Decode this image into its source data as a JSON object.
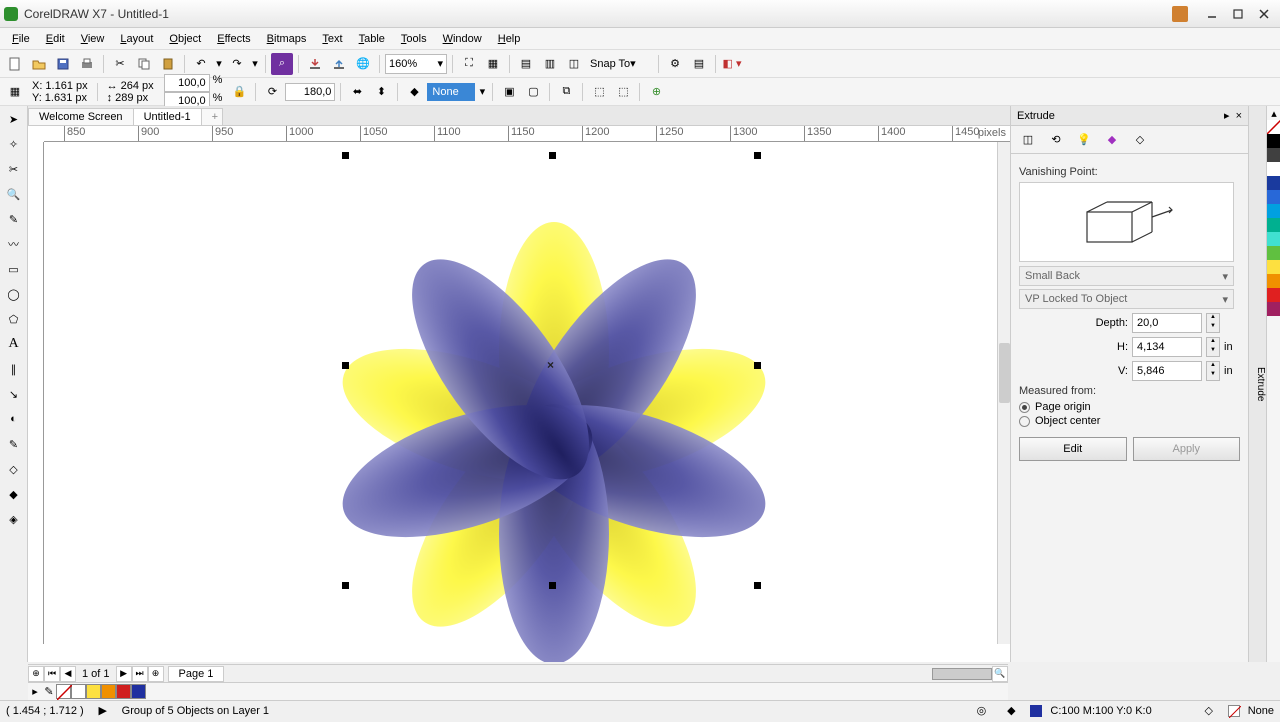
{
  "app": {
    "title": "CorelDRAW X7 - Untitled-1"
  },
  "menus": [
    "File",
    "Edit",
    "View",
    "Layout",
    "Object",
    "Effects",
    "Bitmaps",
    "Text",
    "Table",
    "Tools",
    "Window",
    "Help"
  ],
  "toolbar1": {
    "zoom": "160%",
    "snap": "Snap To"
  },
  "props": {
    "x_label": "X:",
    "x": "1.161 px",
    "y_label": "Y:",
    "y": "1.631 px",
    "w": "264 px",
    "h": "289 px",
    "sx": "100,0",
    "sy": "100,0",
    "pct": "%",
    "rot": "180,0",
    "fill": "None"
  },
  "doc_tabs": {
    "welcome": "Welcome Screen",
    "doc": "Untitled-1"
  },
  "ruler_ticks": [
    "850",
    "900",
    "950",
    "1000",
    "1050",
    "1100",
    "1150",
    "1200",
    "1250",
    "1300",
    "1350",
    "1400",
    "1450"
  ],
  "ruler_unit": "pixels",
  "docker": {
    "title": "Extrude",
    "vp_label": "Vanishing Point:",
    "preset": "Small Back",
    "lock": "VP Locked To Object",
    "depth_label": "Depth:",
    "depth": "20,0",
    "h_label": "H:",
    "h_val": "4,134",
    "unit": "in",
    "v_label": "V:",
    "v_val": "5,846",
    "measured": "Measured from:",
    "opt1": "Page origin",
    "opt2": "Object center",
    "edit": "Edit",
    "apply": "Apply"
  },
  "page_nav": {
    "count": "1 of 1",
    "page": "Page 1"
  },
  "status": {
    "coords": "( 1.454 ; 1.712 )",
    "selection": "Group of 5 Objects on Layer 1",
    "color": "C:100 M:100 Y:0 K:0",
    "outline": "None"
  },
  "palette_colors": [
    "#000000",
    "#404040",
    "#ffffff",
    "#1a3a9e",
    "#2868d8",
    "#00a0e0",
    "#00b090",
    "#40e0d0",
    "#60c040",
    "#fde040",
    "#f09000",
    "#e02020",
    "#a02060"
  ],
  "swatch_colors": [
    "#ffffff",
    "#fde040",
    "#f09000",
    "#d02020",
    "#2030a0"
  ]
}
